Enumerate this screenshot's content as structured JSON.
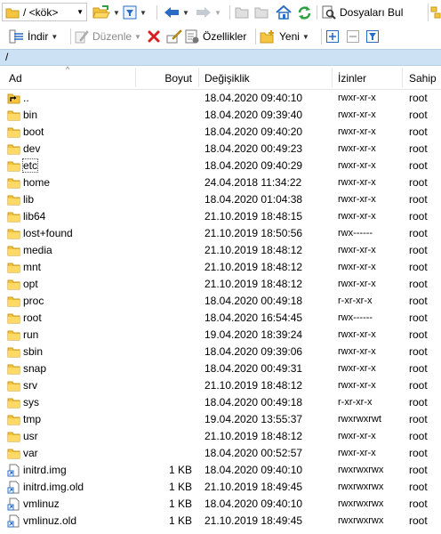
{
  "toolbar1": {
    "path_value": "/ <kök>",
    "find_files_label": "Dosyaları Bul"
  },
  "toolbar2": {
    "download_label": "İndir",
    "edit_label": "Düzenle",
    "properties_label": "Özellikler",
    "new_label": "Yeni"
  },
  "address": {
    "path": "/"
  },
  "columns": {
    "name": "Ad",
    "size": "Boyut",
    "modified": "Değişiklik",
    "permissions": "İzinler",
    "owner": "Sahip"
  },
  "files": [
    {
      "name": "..",
      "size": "",
      "modified": "18.04.2020 09:40:10",
      "permissions": "rwxr-xr-x",
      "owner": "root",
      "type": "parent"
    },
    {
      "name": "bin",
      "size": "",
      "modified": "18.04.2020 09:39:40",
      "permissions": "rwxr-xr-x",
      "owner": "root",
      "type": "folder"
    },
    {
      "name": "boot",
      "size": "",
      "modified": "18.04.2020 09:40:20",
      "permissions": "rwxr-xr-x",
      "owner": "root",
      "type": "folder"
    },
    {
      "name": "dev",
      "size": "",
      "modified": "18.04.2020 00:49:23",
      "permissions": "rwxr-xr-x",
      "owner": "root",
      "type": "folder"
    },
    {
      "name": "etc",
      "size": "",
      "modified": "18.04.2020 09:40:29",
      "permissions": "rwxr-xr-x",
      "owner": "root",
      "type": "folder"
    },
    {
      "name": "home",
      "size": "",
      "modified": "24.04.2018 11:34:22",
      "permissions": "rwxr-xr-x",
      "owner": "root",
      "type": "folder"
    },
    {
      "name": "lib",
      "size": "",
      "modified": "18.04.2020 01:04:38",
      "permissions": "rwxr-xr-x",
      "owner": "root",
      "type": "folder"
    },
    {
      "name": "lib64",
      "size": "",
      "modified": "21.10.2019 18:48:15",
      "permissions": "rwxr-xr-x",
      "owner": "root",
      "type": "folder"
    },
    {
      "name": "lost+found",
      "size": "",
      "modified": "21.10.2019 18:50:56",
      "permissions": "rwx------",
      "owner": "root",
      "type": "folder"
    },
    {
      "name": "media",
      "size": "",
      "modified": "21.10.2019 18:48:12",
      "permissions": "rwxr-xr-x",
      "owner": "root",
      "type": "folder"
    },
    {
      "name": "mnt",
      "size": "",
      "modified": "21.10.2019 18:48:12",
      "permissions": "rwxr-xr-x",
      "owner": "root",
      "type": "folder"
    },
    {
      "name": "opt",
      "size": "",
      "modified": "21.10.2019 18:48:12",
      "permissions": "rwxr-xr-x",
      "owner": "root",
      "type": "folder"
    },
    {
      "name": "proc",
      "size": "",
      "modified": "18.04.2020 00:49:18",
      "permissions": "r-xr-xr-x",
      "owner": "root",
      "type": "folder"
    },
    {
      "name": "root",
      "size": "",
      "modified": "18.04.2020 16:54:45",
      "permissions": "rwx------",
      "owner": "root",
      "type": "folder"
    },
    {
      "name": "run",
      "size": "",
      "modified": "19.04.2020 18:39:24",
      "permissions": "rwxr-xr-x",
      "owner": "root",
      "type": "folder"
    },
    {
      "name": "sbin",
      "size": "",
      "modified": "18.04.2020 09:39:06",
      "permissions": "rwxr-xr-x",
      "owner": "root",
      "type": "folder"
    },
    {
      "name": "snap",
      "size": "",
      "modified": "18.04.2020 00:49:31",
      "permissions": "rwxr-xr-x",
      "owner": "root",
      "type": "folder"
    },
    {
      "name": "srv",
      "size": "",
      "modified": "21.10.2019 18:48:12",
      "permissions": "rwxr-xr-x",
      "owner": "root",
      "type": "folder"
    },
    {
      "name": "sys",
      "size": "",
      "modified": "18.04.2020 00:49:18",
      "permissions": "r-xr-xr-x",
      "owner": "root",
      "type": "folder"
    },
    {
      "name": "tmp",
      "size": "",
      "modified": "19.04.2020 13:55:37",
      "permissions": "rwxrwxrwt",
      "owner": "root",
      "type": "folder"
    },
    {
      "name": "usr",
      "size": "",
      "modified": "21.10.2019 18:48:12",
      "permissions": "rwxr-xr-x",
      "owner": "root",
      "type": "folder"
    },
    {
      "name": "var",
      "size": "",
      "modified": "18.04.2020 00:52:57",
      "permissions": "rwxr-xr-x",
      "owner": "root",
      "type": "folder"
    },
    {
      "name": "initrd.img",
      "size": "1 KB",
      "modified": "18.04.2020 09:40:10",
      "permissions": "rwxrwxrwx",
      "owner": "root",
      "type": "link"
    },
    {
      "name": "initrd.img.old",
      "size": "1 KB",
      "modified": "21.10.2019 18:49:45",
      "permissions": "rwxrwxrwx",
      "owner": "root",
      "type": "link"
    },
    {
      "name": "vmlinuz",
      "size": "1 KB",
      "modified": "18.04.2020 09:40:10",
      "permissions": "rwxrwxrwx",
      "owner": "root",
      "type": "link"
    },
    {
      "name": "vmlinuz.old",
      "size": "1 KB",
      "modified": "21.10.2019 18:49:45",
      "permissions": "rwxrwxrwx",
      "owner": "root",
      "type": "link"
    }
  ],
  "focused_item": "etc",
  "colors": {
    "folder": "#f5c542",
    "address_bar": "#cde1f5",
    "nav_blue": "#2a6cc4",
    "delete_red": "#d42020",
    "refresh_green": "#2ea043"
  }
}
